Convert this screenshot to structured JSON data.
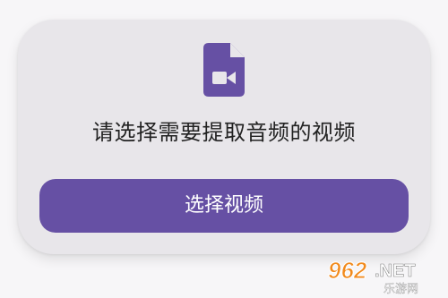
{
  "dialog": {
    "icon": "video-file-icon",
    "prompt": "请选择需要提取音频的视频",
    "button_label": "选择视频"
  },
  "watermark": {
    "logo_text": "962.NET",
    "site_name": "乐游网"
  },
  "colors": {
    "accent": "#6650a4",
    "card_background": "#e8e6ea",
    "prompt_text": "#222222",
    "watermark_orange": "#f18a1c"
  }
}
